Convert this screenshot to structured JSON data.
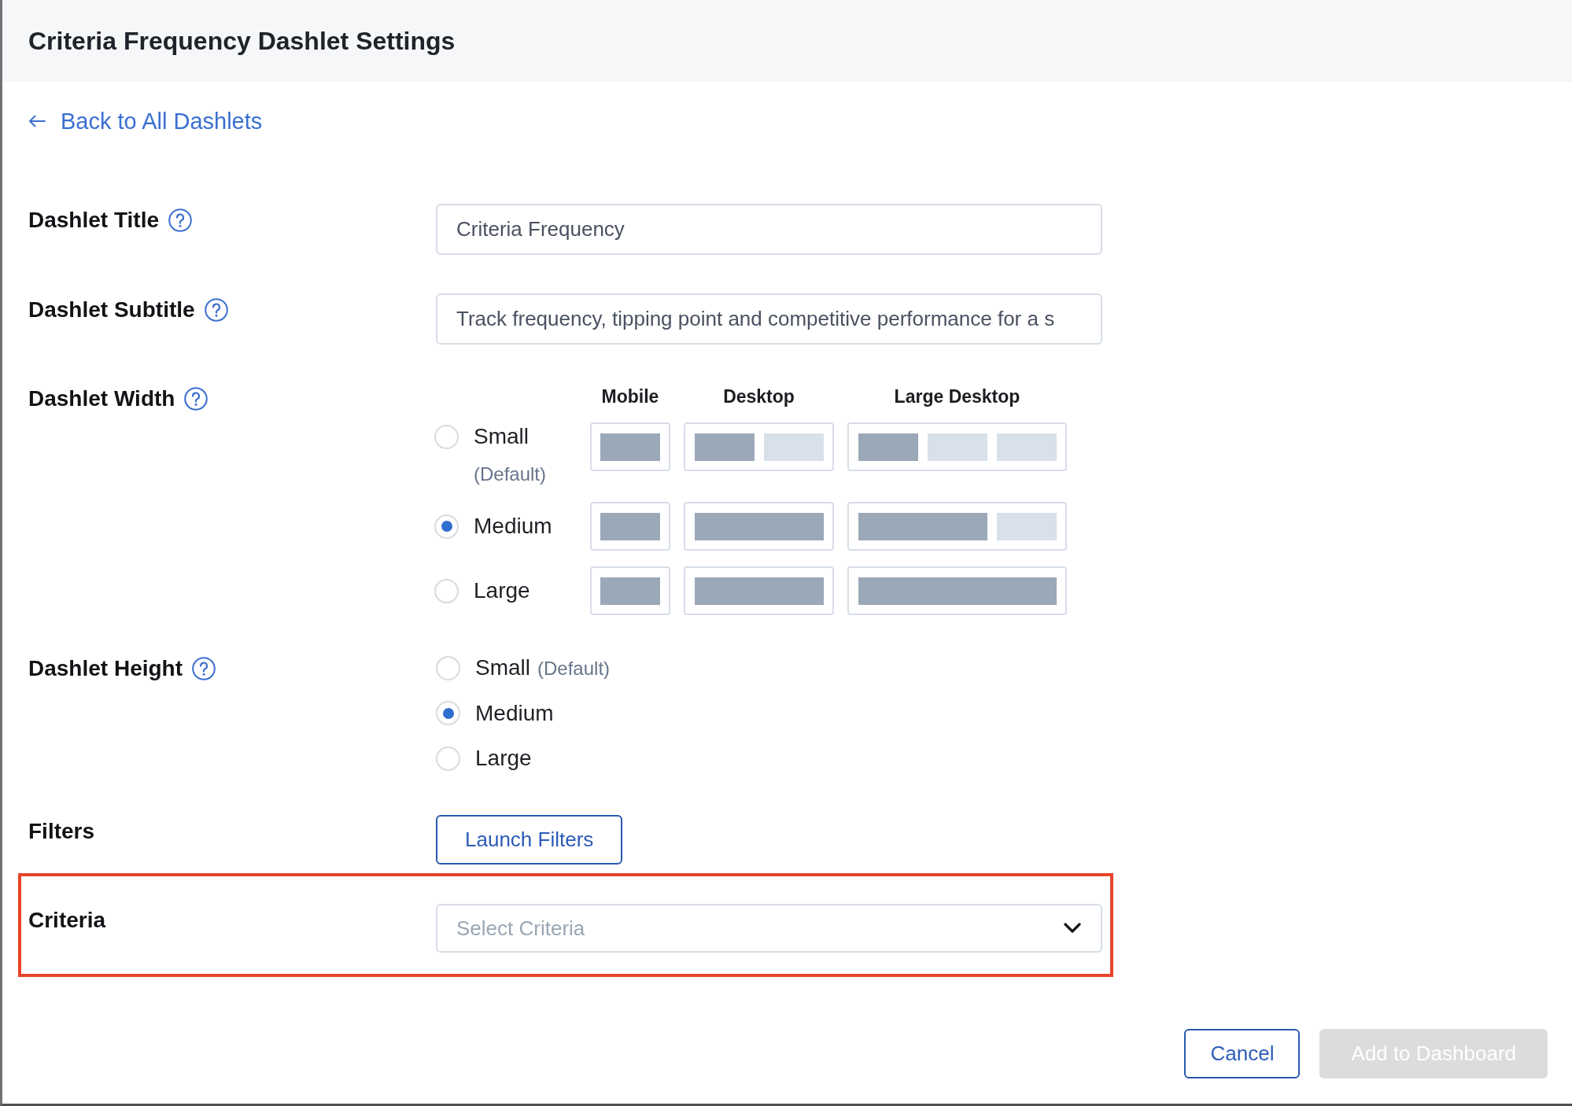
{
  "header": {
    "title": "Criteria Frequency Dashlet Settings"
  },
  "back_link": {
    "label": "Back to All Dashlets"
  },
  "fields": [
    {
      "kind": "text",
      "label": "Dashlet Title",
      "help": true,
      "value": "Criteria Frequency"
    },
    {
      "kind": "text",
      "label": "Dashlet Subtitle",
      "help": true,
      "value": "Track frequency, tipping point and competitive performance for a s"
    },
    {
      "kind": "width",
      "label": "Dashlet Width",
      "help": true,
      "columns": [
        "Mobile",
        "Desktop",
        "Large Desktop"
      ],
      "options": [
        {
          "label": "Small",
          "note": "(Default)",
          "selected": false,
          "previews": [
            {
              "blocks": [
                {
                  "kind": "single",
                  "filled": true
                }
              ]
            },
            {
              "blocks": [
                {
                  "kind": "single",
                  "filled": true
                },
                {
                  "kind": "single",
                  "filled": false
                }
              ]
            },
            {
              "blocks": [
                {
                  "kind": "single",
                  "filled": true
                },
                {
                  "kind": "single",
                  "filled": false
                },
                {
                  "kind": "single",
                  "filled": false
                }
              ]
            }
          ]
        },
        {
          "label": "Medium",
          "selected": true,
          "previews": [
            {
              "blocks": [
                {
                  "kind": "single",
                  "filled": true
                }
              ]
            },
            {
              "blocks": [
                {
                  "kind": "double",
                  "filled": true
                }
              ]
            },
            {
              "blocks": [
                {
                  "kind": "double",
                  "filled": true
                },
                {
                  "kind": "single",
                  "filled": false
                }
              ]
            }
          ]
        },
        {
          "label": "Large",
          "selected": false,
          "previews": [
            {
              "blocks": [
                {
                  "kind": "single",
                  "filled": true
                }
              ]
            },
            {
              "blocks": [
                {
                  "kind": "double",
                  "filled": true
                }
              ]
            },
            {
              "blocks": [
                {
                  "kind": "triple",
                  "filled": true
                }
              ]
            }
          ]
        }
      ]
    },
    {
      "kind": "radio",
      "label": "Dashlet Height",
      "help": true,
      "options": [
        {
          "label": "Small",
          "note": "(Default)",
          "selected": false
        },
        {
          "label": "Medium",
          "selected": true
        },
        {
          "label": "Large",
          "selected": false
        }
      ]
    },
    {
      "kind": "button",
      "label": "Filters",
      "help": false,
      "button": "Launch Filters"
    },
    {
      "kind": "select",
      "label": "Criteria",
      "help": false,
      "placeholder": "Select Criteria",
      "highlighted": true
    }
  ],
  "footer": {
    "buttons": [
      {
        "label": "Cancel",
        "kind": "secondary",
        "disabled": false
      },
      {
        "label": "Add to Dashboard",
        "kind": "primary",
        "disabled": true
      }
    ]
  }
}
